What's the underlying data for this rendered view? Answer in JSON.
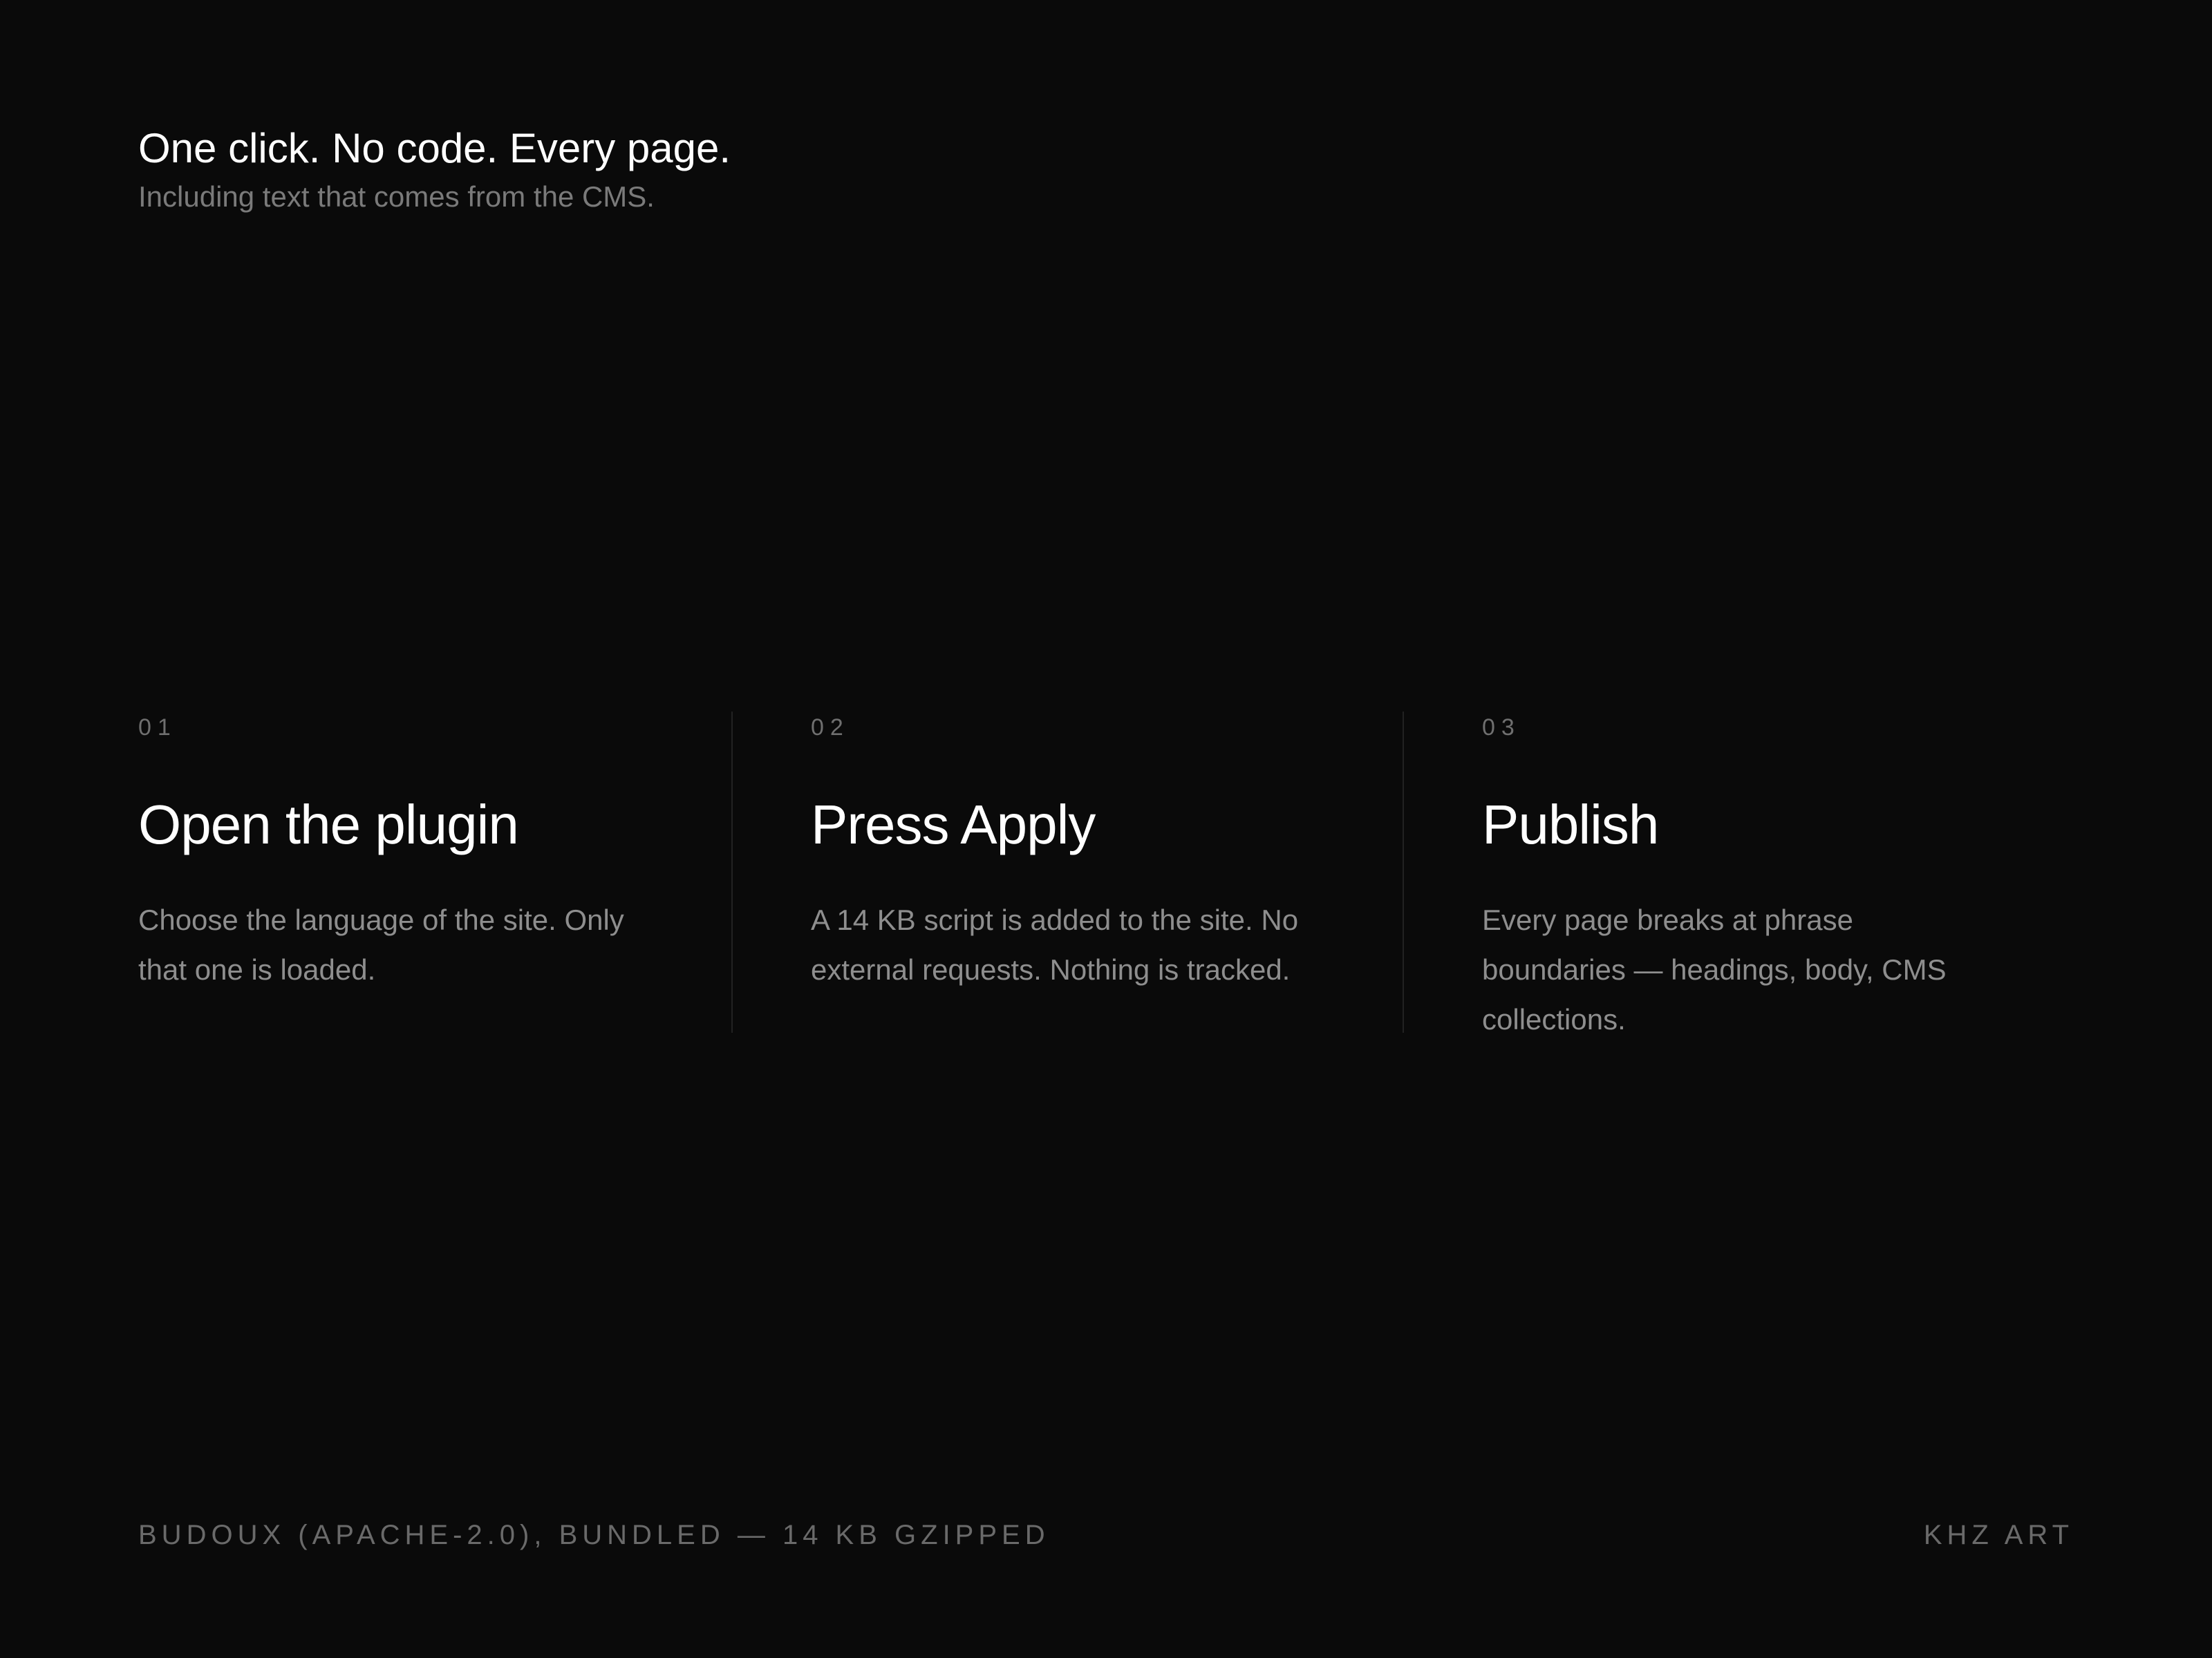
{
  "header": {
    "headline": "One click. No code. Every page.",
    "subline": "Including text that comes from the CMS."
  },
  "steps": [
    {
      "number": "01",
      "title": "Open the plugin",
      "description": "Choose the language of the site. Only that one is loaded."
    },
    {
      "number": "02",
      "title": "Press Apply",
      "description": "A 14 KB script is added to the site. No external requests. Nothing is tracked."
    },
    {
      "number": "03",
      "title": "Publish",
      "description": "Every page breaks at phrase boundaries — headings, body, CMS collections."
    }
  ],
  "footer": {
    "left": "BUDOUX (APACHE-2.0), BUNDLED — 14 KB GZIPPED",
    "right": "KHZ ART"
  },
  "colors": {
    "background": "#0a0a0a",
    "headline": "#ffffff",
    "muted": "#7a7a7a",
    "divider": "#222222"
  }
}
